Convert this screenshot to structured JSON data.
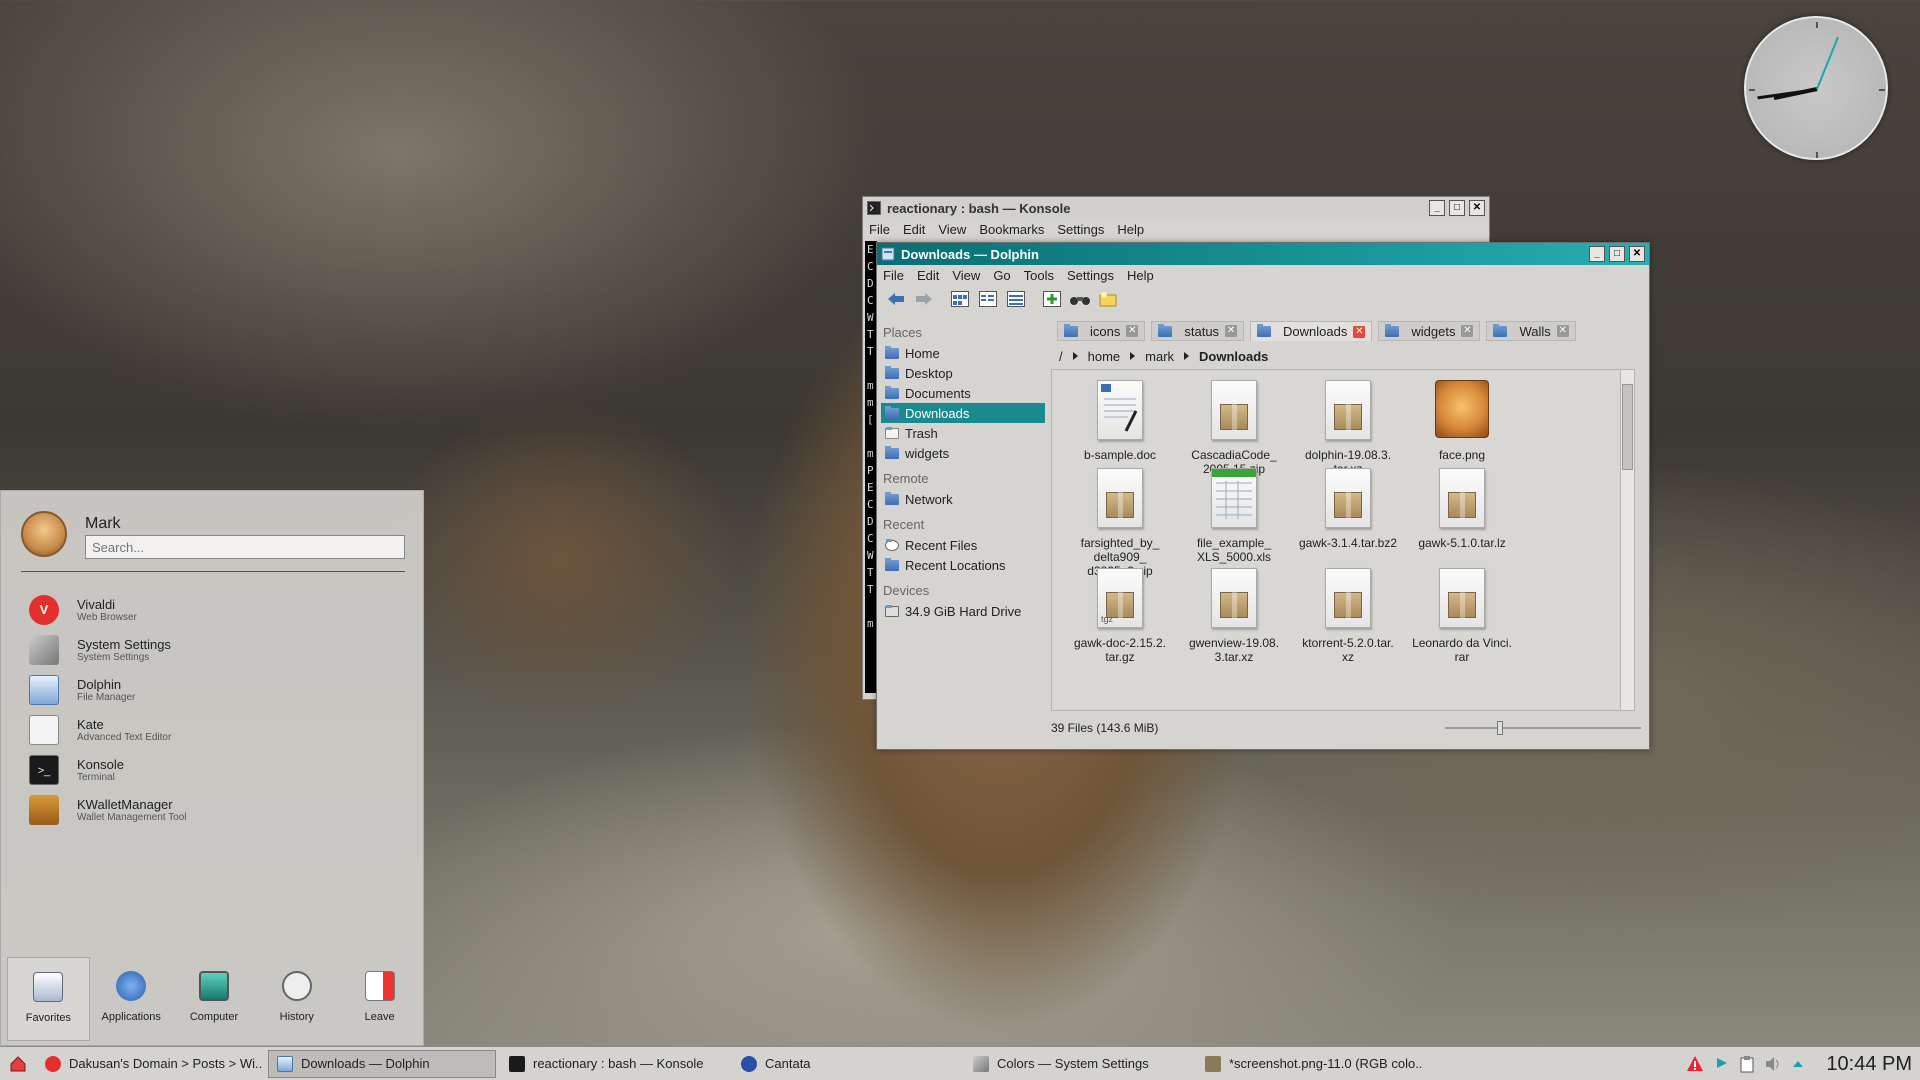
{
  "konsole": {
    "title": "reactionary : bash — Konsole",
    "menu": [
      "File",
      "Edit",
      "View",
      "Bookmarks",
      "Settings",
      "Help"
    ],
    "terminal_chars": [
      "E",
      "C",
      "D",
      "C",
      "W",
      "T",
      "T",
      "",
      "m",
      "m",
      "[",
      "",
      "m",
      "P",
      "E",
      "C",
      "D",
      "C",
      "W",
      "T",
      "T",
      "",
      "m"
    ]
  },
  "dolphin": {
    "title": "Downloads — Dolphin",
    "menu": [
      "File",
      "Edit",
      "View",
      "Go",
      "Tools",
      "Settings",
      "Help"
    ],
    "places": {
      "header_places": "Places",
      "places_items": [
        "Home",
        "Desktop",
        "Documents",
        "Downloads",
        "Trash",
        "widgets"
      ],
      "header_remote": "Remote",
      "remote_items": [
        "Network"
      ],
      "header_recent": "Recent",
      "recent_items": [
        "Recent Files",
        "Recent Locations"
      ],
      "header_devices": "Devices",
      "device_items": [
        "34.9 GiB Hard Drive"
      ]
    },
    "tabs": [
      "icons",
      "status",
      "Downloads",
      "widgets",
      "Walls"
    ],
    "breadcrumb": {
      "root": "/",
      "parts": [
        "home",
        "mark",
        "Downloads"
      ]
    },
    "files": [
      "b-sample.doc",
      "CascadiaCode_\n2005.15.zip",
      "dolphin-19.08.3.\ntar.xz",
      "face.png",
      "farsighted_by_\ndelta909_\nd3825a3.zip",
      "file_example_\nXLS_5000.xls",
      "gawk-3.1.4.tar.bz2",
      "gawk-5.1.0.tar.lz",
      "gawk-doc-2.15.2.\ntar.gz",
      "gwenview-19.08.\n3.tar.xz",
      "ktorrent-5.2.0.tar.\nxz",
      "Leonardo da Vinci.\nrar"
    ],
    "tgz_label": "tgz",
    "status": "39 Files (143.6 MiB)"
  },
  "kickoff": {
    "user": "Mark",
    "search_placeholder": "Search...",
    "apps": [
      {
        "name": "Vivaldi",
        "desc": "Web Browser"
      },
      {
        "name": "System Settings",
        "desc": "System Settings"
      },
      {
        "name": "Dolphin",
        "desc": "File Manager"
      },
      {
        "name": "Kate",
        "desc": "Advanced Text Editor"
      },
      {
        "name": "Konsole",
        "desc": "Terminal"
      },
      {
        "name": "KWalletManager",
        "desc": "Wallet Management Tool"
      }
    ],
    "tabs": [
      "Favorites",
      "Applications",
      "Computer",
      "History",
      "Leave"
    ]
  },
  "taskbar": {
    "tasks": [
      "Dakusan's Domain > Posts > Wi...",
      "Downloads — Dolphin",
      "reactionary : bash — Konsole",
      "Cantata",
      "Colors  — System Settings",
      "*screenshot.png-11.0 (RGB colo..."
    ],
    "clock": "10:44 PM"
  },
  "colors": {
    "accent": "#1b8a8e",
    "title_active": "#0a6e72"
  }
}
